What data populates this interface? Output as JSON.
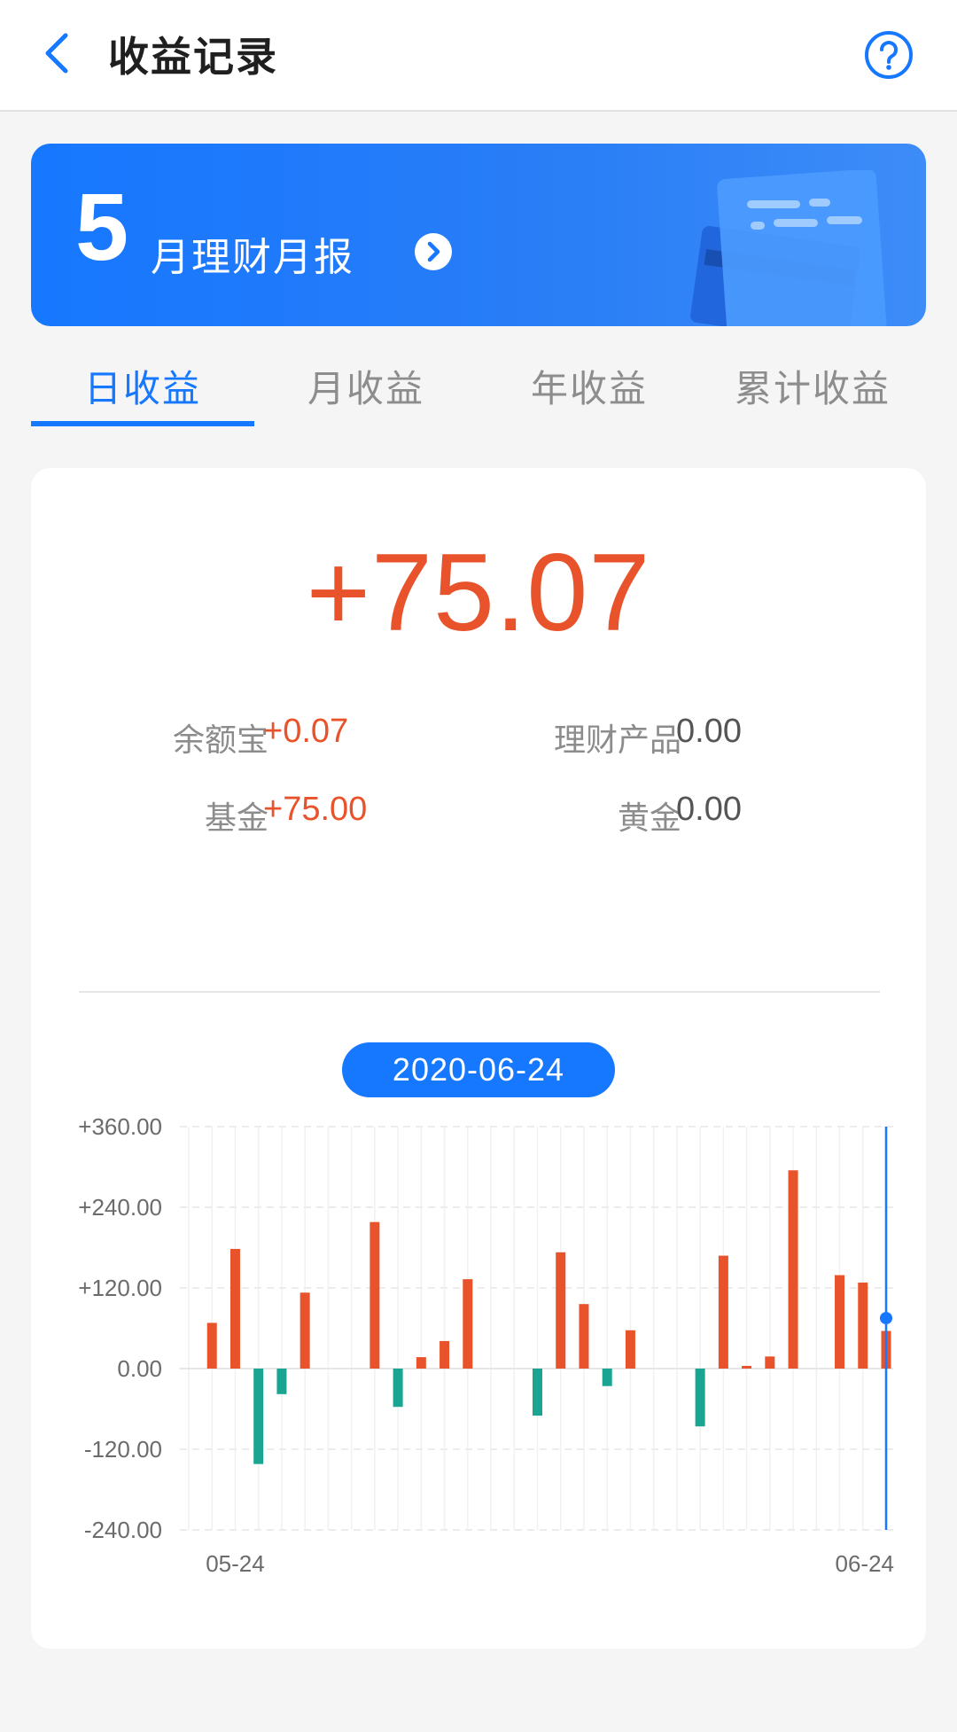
{
  "header": {
    "title": "收益记录"
  },
  "banner": {
    "month": "5",
    "text": "月理财月报"
  },
  "tabs": [
    {
      "label": "日收益",
      "active": true
    },
    {
      "label": "月收益",
      "active": false
    },
    {
      "label": "年收益",
      "active": false
    },
    {
      "label": "累计收益",
      "active": false
    }
  ],
  "summary": {
    "total": "+75.07",
    "items": [
      {
        "label": "余额宝",
        "value": "+0.07"
      },
      {
        "label": "理财产品",
        "value": "0.00"
      },
      {
        "label": "基金",
        "value": "+75.00"
      },
      {
        "label": "黄金",
        "value": "0.00"
      }
    ]
  },
  "selected_date": "2020-06-24",
  "colors": {
    "accent": "#1677ff",
    "positive": "#e8532b",
    "negative": "#1aa592"
  },
  "chart_data": {
    "type": "bar",
    "ylim": [
      -240,
      360
    ],
    "y_ticks": [
      "+360.00",
      "+240.00",
      "+120.00",
      "0.00",
      "-120.00",
      "-240.00"
    ],
    "y_tick_values": [
      360,
      240,
      120,
      0,
      -120,
      -240
    ],
    "x_tick_labels": [
      "05-24",
      "06-24"
    ],
    "values": [
      0,
      68,
      178,
      -142,
      -38,
      113,
      0,
      0,
      218,
      -57,
      17,
      41,
      133,
      0,
      0,
      -70,
      173,
      96,
      -26,
      57,
      0,
      0,
      -86,
      168,
      4,
      18,
      295,
      0,
      139,
      128,
      56
    ],
    "selected_index": 30,
    "selected_value": 75.07
  }
}
